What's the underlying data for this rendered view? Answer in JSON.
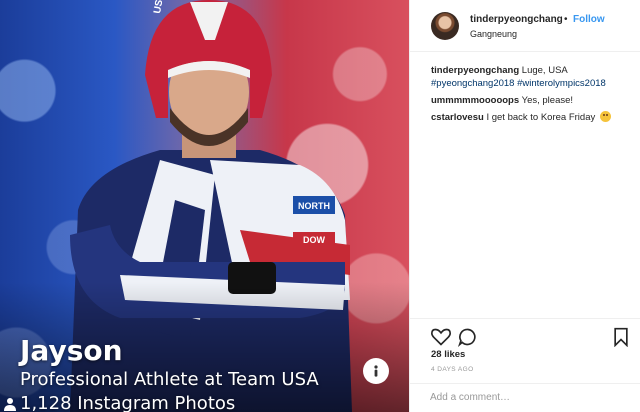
{
  "post": {
    "photo": {
      "name_caption": "Jayson",
      "role_caption": "Professional Athlete at Team USA",
      "photo_count": "1,128 Instagram Photos",
      "suit_brand_arm": "NORTH",
      "suit_brand_sleeve": "DOW",
      "helmet_mark": "USA"
    },
    "header": {
      "username": "tinderpyeongchang",
      "separator": "•",
      "follow_label": "Follow",
      "location": "Gangneung"
    },
    "comments": [
      {
        "user": "tinderpyeongchang",
        "text": "Luge, USA",
        "tags": "#pyeongchang2018 #winterolympics2018"
      },
      {
        "user": "ummmmmooooops",
        "text": "Yes, please!"
      },
      {
        "user": "cstarlovesu",
        "text": "I get back to Korea Friday",
        "emoji": "smiling-face-emoji"
      }
    ],
    "likes": "28 likes",
    "time_ago": "4 DAYS AGO",
    "add_comment_placeholder": "Add a comment…"
  },
  "icons": [
    "heart-icon",
    "comment-icon",
    "bookmark-icon",
    "info-icon",
    "person-icon"
  ],
  "colors": {
    "follow_blue": "#3897f0",
    "hashtag_blue": "#003569",
    "border": "#efefef",
    "muted_text": "#999999"
  }
}
